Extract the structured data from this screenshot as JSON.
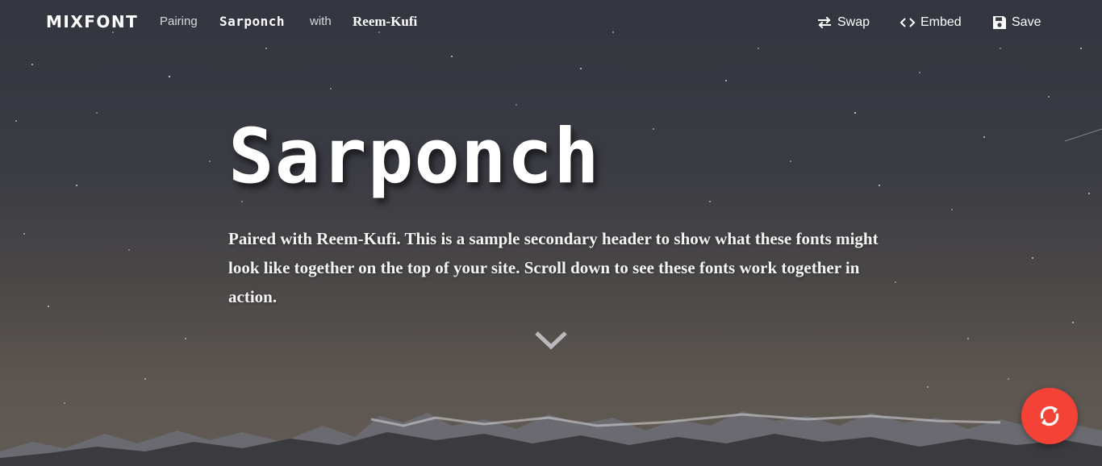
{
  "nav": {
    "logo": "MIXFONT",
    "pairing_label": "Pairing",
    "primary_font": "Sarponch",
    "with_label": "with",
    "secondary_font": "Reem-Kufi",
    "actions": {
      "swap": "Swap",
      "embed": "Embed",
      "save": "Save"
    },
    "icons": {
      "swap": "swap-arrows-icon",
      "embed": "code-brackets-icon",
      "save": "floppy-disk-icon"
    }
  },
  "hero": {
    "headline": "Sarponch",
    "subheader": "Paired with Reem-Kufi. This is a sample secondary header to show what these fonts might look like together on the top of your site. Scroll down to see these fonts work together in action.",
    "scroll_icon": "chevron-down-icon"
  },
  "fab": {
    "icon": "refresh-icon",
    "color": "#f44336"
  }
}
